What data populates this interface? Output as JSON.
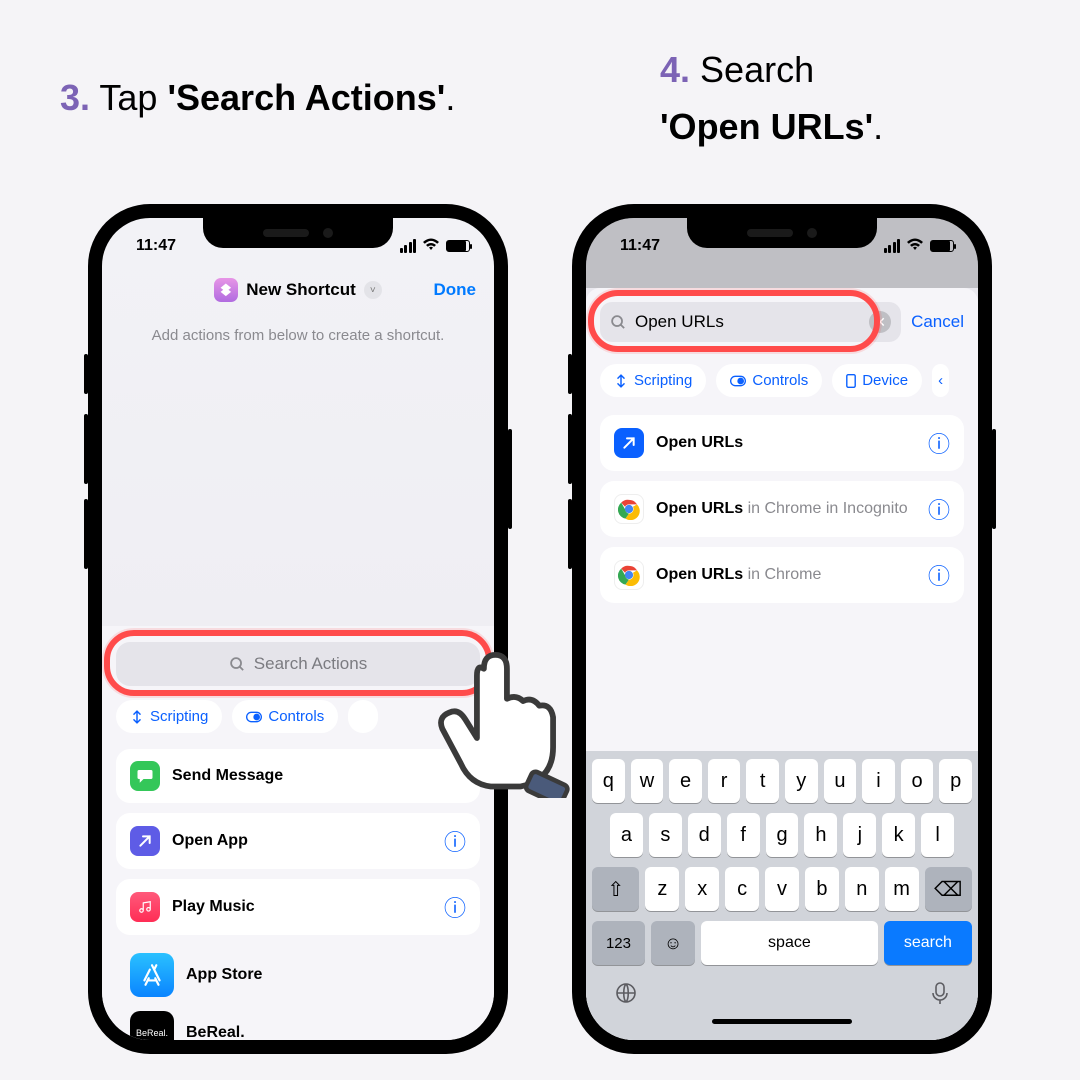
{
  "steps": {
    "s3": {
      "num": "3.",
      "text": "Tap ",
      "bold": "'Search Actions'",
      "after": "."
    },
    "s4": {
      "num": "4.",
      "text": "Search",
      "line2_bold": "'Open URLs'",
      "line2_after": "."
    }
  },
  "status": {
    "time_left": "11:47",
    "time_right": "11:47"
  },
  "left": {
    "nav_title": "New Shortcut",
    "done": "Done",
    "hint": "Add actions from below to create a shortcut.",
    "search_placeholder": "Search Actions",
    "chips": [
      "Scripting",
      "Controls"
    ],
    "actions": [
      {
        "label": "Send Message",
        "info": false,
        "icon": "message",
        "color": "#34c759"
      },
      {
        "label": "Open App",
        "info": true,
        "icon": "arrow",
        "color": "#4e5bd8"
      },
      {
        "label": "Play Music",
        "info": true,
        "icon": "music",
        "color": "#ff2d55"
      },
      {
        "label": "App Store",
        "info": false,
        "icon": "appstore",
        "color": "#0a84ff"
      },
      {
        "label": "BeReal.",
        "info": false,
        "icon": "bereal",
        "color": "#000"
      }
    ]
  },
  "right": {
    "search_value": "Open URLs",
    "cancel": "Cancel",
    "chips": [
      "Scripting",
      "Controls",
      "Device"
    ],
    "results": [
      {
        "main": "Open URLs",
        "sub": "",
        "icon": "safari",
        "color": "#0a60ff"
      },
      {
        "main": "Open URLs",
        "sub": "in Chrome in Incognito",
        "icon": "chrome",
        "color": "#fff"
      },
      {
        "main": "Open URLs",
        "sub": "in Chrome",
        "icon": "chrome",
        "color": "#fff"
      }
    ],
    "kbd_rows": [
      [
        "q",
        "w",
        "e",
        "r",
        "t",
        "y",
        "u",
        "i",
        "o",
        "p"
      ],
      [
        "a",
        "s",
        "d",
        "f",
        "g",
        "h",
        "j",
        "k",
        "l"
      ],
      [
        "⇧",
        "z",
        "x",
        "c",
        "v",
        "b",
        "n",
        "m",
        "⌫"
      ]
    ],
    "kbd_bottom": {
      "n123": "123",
      "emoji": "☺",
      "space": "space",
      "search": "search"
    }
  }
}
